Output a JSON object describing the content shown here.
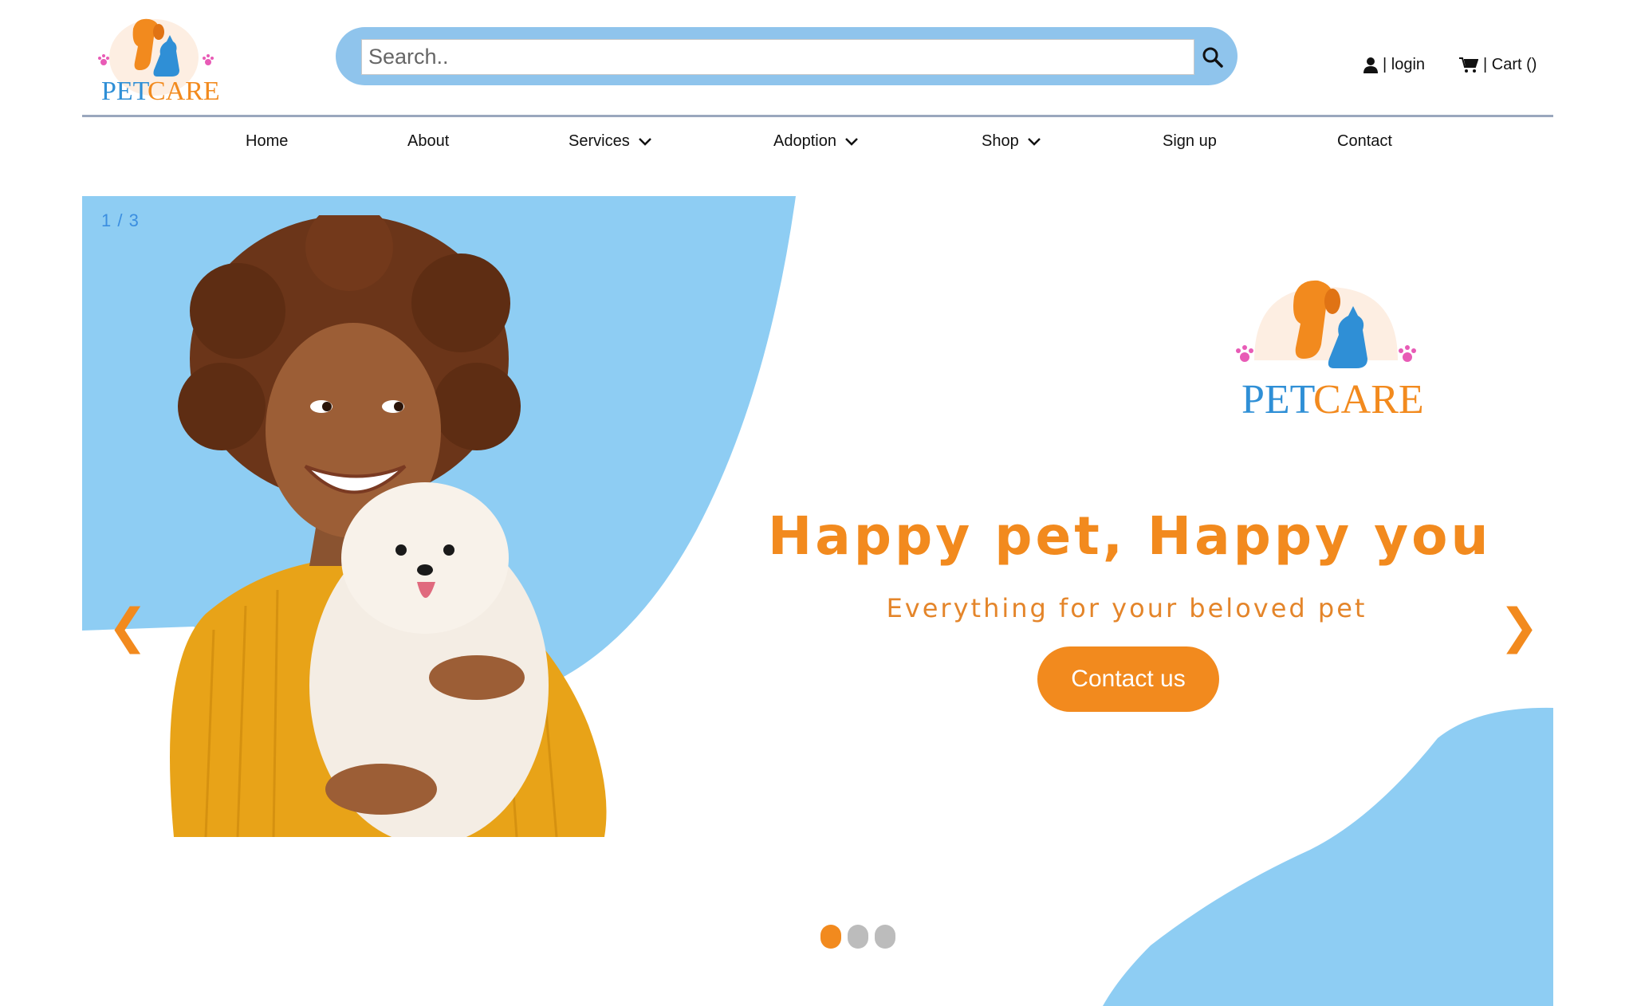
{
  "logo": {
    "pet": "PET",
    "care": "CARE"
  },
  "search": {
    "placeholder": "Search.."
  },
  "account": {
    "login_label": "| login",
    "cart_label": "| Cart ()"
  },
  "nav": {
    "home": "Home",
    "about": "About",
    "services": "Services",
    "adoption": "Adoption",
    "shop": "Shop",
    "signup": "Sign up",
    "contact": "Contact"
  },
  "hero": {
    "counter": "1 / 3",
    "title": "Happy pet, Happy you",
    "subtitle": "Everything for your beloved pet",
    "cta": "Contact us",
    "prev_arrow": "❮",
    "next_arrow": "❯",
    "slides_total": 3,
    "active_slide": 1
  },
  "colors": {
    "brand_orange": "#f28a1e",
    "brand_blue": "#2f8fd6",
    "sky_blue": "#8ecdf3",
    "search_bar": "#8fc4ec"
  }
}
